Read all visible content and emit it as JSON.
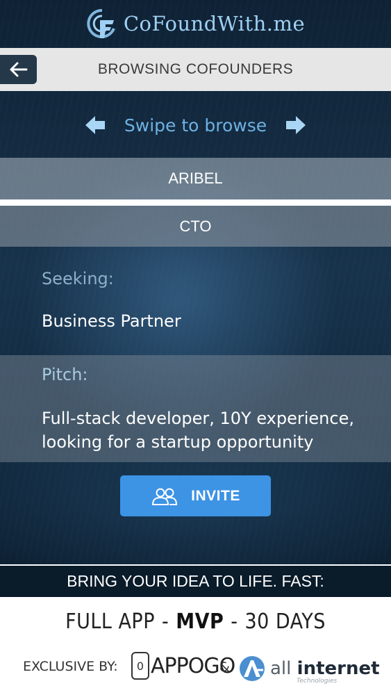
{
  "header": {
    "app_name": "CoFoundWith.me",
    "logo_icon": "cofound-logo-icon"
  },
  "titlebar": {
    "back_icon": "arrow-left-icon",
    "title": "BROWSING COFOUNDERS"
  },
  "swipe": {
    "label": "Swipe to browse",
    "left_icon": "arrow-left-icon",
    "right_icon": "arrow-right-icon"
  },
  "profile": {
    "name": "ARIBEL",
    "role": "CTO",
    "seeking_label": "Seeking:",
    "seeking_value": "Business Partner",
    "pitch_label": "Pitch:",
    "pitch_value": "Full-stack developer, 10Y experience, looking for a startup opportunity"
  },
  "invite": {
    "label": "INVITE",
    "icon": "users-icon"
  },
  "promo": {
    "banner": "BRING YOUR IDEA TO LIFE. FAST:",
    "offer_part1": "FULL APP",
    "offer_sep1": "-",
    "offer_part2": "MVP",
    "offer_sep2": "-",
    "offer_part3": "30 DAYS",
    "exclusive_label": "EXCLUSIVE BY:",
    "brand1": "APPOGO",
    "brand1_mark": "0",
    "ampersand": "&",
    "brand2_part1": "all",
    "brand2_part2": "internet",
    "brand2_sub": "Technologies"
  },
  "colors": {
    "accent": "#3d93e4",
    "logo_text": "#9fd0f3",
    "swipe_text": "#6fb1e2",
    "titlebar_bg": "#e6e6e6"
  }
}
